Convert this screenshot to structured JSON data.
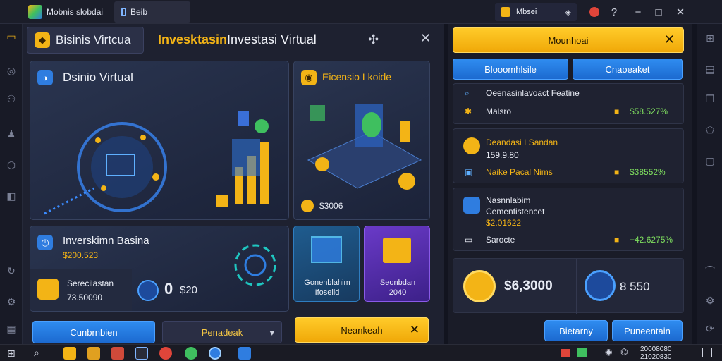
{
  "titlebar": {
    "app_title": "Mobnis slobdai",
    "tab_label": "Beib",
    "user_label": "Mbsei",
    "minimize": "−",
    "maximize": "□",
    "close": "✕",
    "help": "?"
  },
  "main": {
    "header_chip": "Bisinis Virtcua",
    "header_brand": "Invesktasin",
    "header_title": "Investasi Virtual",
    "close": "✕",
    "card_virtual": {
      "title": "Dsinio Virtual"
    },
    "card_economic": {
      "title": "Eicensio I koide",
      "amount": "$3006"
    },
    "card_invest": {
      "title": "Inverskimn Basina",
      "amount": "$200.523",
      "label": "Serecilastan",
      "sub_amount": "73.50090",
      "count": "0",
      "count_amount": "$20"
    },
    "tile_blue": {
      "line1": "Gonenblahim",
      "line2": "Ifoseiid"
    },
    "tile_purple": {
      "line1": "Seonbdan",
      "line2": "2040"
    },
    "buttons": {
      "primary": "Cunbrnbien",
      "dropdown": "Penadeak",
      "gold": "Neankeah"
    }
  },
  "right": {
    "top_button": "Mounhoai",
    "tab1": "Blooomhlsile",
    "tab2": "Cnaoeaket",
    "row1": {
      "title": "Oeenasinlavoact Featine",
      "label": "Malsro",
      "value": "$58.527%"
    },
    "row2": {
      "title": "Deandasi I Sandan",
      "sub": "159.9.80",
      "label": "Naike Pacal Nims",
      "value": "$38552%"
    },
    "row3": {
      "title": "Nasnnlabim",
      "sub": "Cemenfistencet",
      "amount": "$2.01622",
      "label": "Sarocte",
      "value": "+42.6275%"
    },
    "balance1": "$6,3000",
    "balance2": "8 550",
    "btn_left": "Bietarny",
    "btn_right": "Puneentain"
  },
  "taskbar": {
    "clock_top": "20008080",
    "clock_bottom": "21020830"
  },
  "colors": {
    "accent_gold": "#f3b416",
    "accent_blue": "#2f7de0",
    "positive": "#7fe05f"
  }
}
